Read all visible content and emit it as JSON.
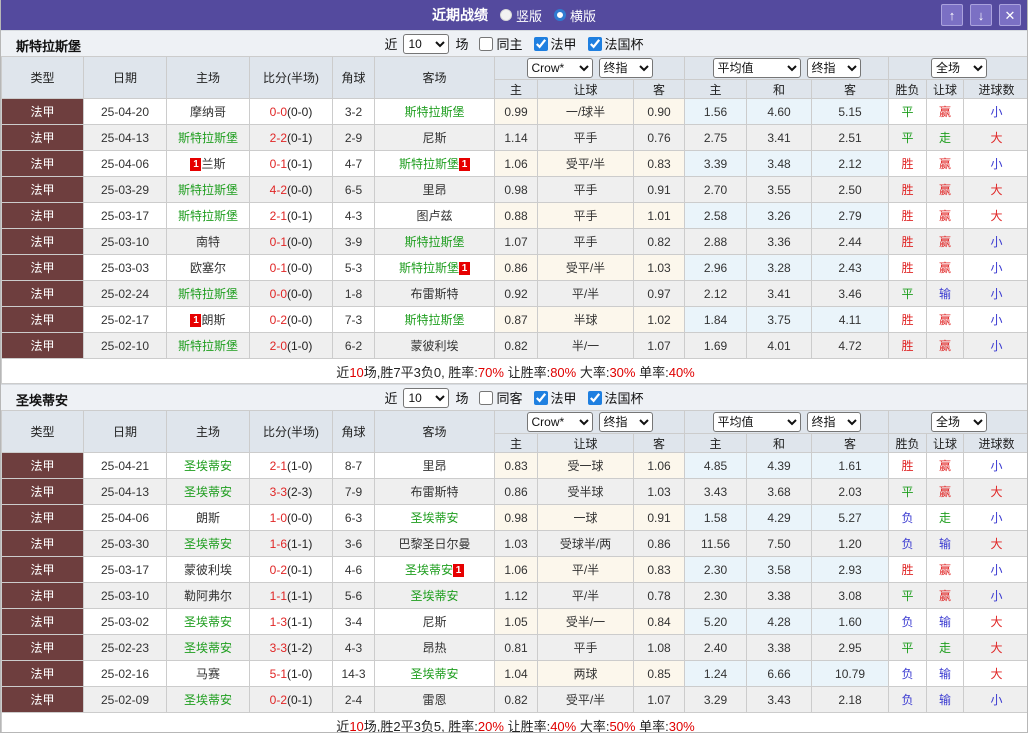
{
  "titlebar": {
    "title": "近期战绩",
    "vertical_label": "竖版",
    "horizontal_label": "横版",
    "buttons": {
      "up": "↑",
      "down": "↓",
      "close": "✕"
    },
    "bar_color": "#544a9e"
  },
  "filters": {
    "near_label": "近",
    "count_value": "10",
    "matches_label": "场",
    "league_label": "法甲",
    "cup_label": "法国杯"
  },
  "header": {
    "type": "类型",
    "date": "日期",
    "home": "主场",
    "score": "比分(半场)",
    "corner": "角球",
    "away": "客场",
    "selects": {
      "company": "Crow*",
      "final": "终指",
      "average": "平均值",
      "full": "全场"
    },
    "sub": {
      "home_odds": "主",
      "handicap": "让球",
      "away_odds": "客",
      "avg_home": "主",
      "avg_draw": "和",
      "avg_away": "客",
      "result": "胜负",
      "handicap_result": "让球",
      "goals": "进球数"
    }
  },
  "status_colors": {
    "win": "#e02626",
    "draw": "#1f9e1f",
    "lose": "#3b3bd1",
    "team": "#1f9e1f",
    "type_bg": "#6e3e3e"
  },
  "sections": [
    {
      "team": "斯特拉斯堡",
      "same_label": "同主",
      "rows": [
        {
          "league": "法甲",
          "date": "25-04-20",
          "home": "摩纳哥",
          "home_card": 0,
          "ft": "0-0",
          "ht": "(0-0)",
          "corner": "3-2",
          "away": "斯特拉斯堡",
          "away_card": 0,
          "o1": "0.99",
          "hc": "一/球半",
          "o2": "0.90",
          "a1": "1.56",
          "a2": "4.60",
          "a3": "5.15",
          "r1": "平",
          "r2": "赢",
          "r3": "小"
        },
        {
          "league": "法甲",
          "date": "25-04-13",
          "home": "斯特拉斯堡",
          "home_card": 0,
          "ft": "2-2",
          "ht": "(0-1)",
          "corner": "2-9",
          "away": "尼斯",
          "away_card": 0,
          "o1": "1.14",
          "hc": "平手",
          "o2": "0.76",
          "a1": "2.75",
          "a2": "3.41",
          "a3": "2.51",
          "r1": "平",
          "r2": "走",
          "r3": "大"
        },
        {
          "league": "法甲",
          "date": "25-04-06",
          "home": "兰斯",
          "home_card": 1,
          "ft": "0-1",
          "ht": "(0-1)",
          "corner": "4-7",
          "away": "斯特拉斯堡",
          "away_card": 1,
          "o1": "1.06",
          "hc": "受平/半",
          "o2": "0.83",
          "a1": "3.39",
          "a2": "3.48",
          "a3": "2.12",
          "r1": "胜",
          "r2": "赢",
          "r3": "小"
        },
        {
          "league": "法甲",
          "date": "25-03-29",
          "home": "斯特拉斯堡",
          "home_card": 0,
          "ft": "4-2",
          "ht": "(0-0)",
          "corner": "6-5",
          "away": "里昂",
          "away_card": 0,
          "o1": "0.98",
          "hc": "平手",
          "o2": "0.91",
          "a1": "2.70",
          "a2": "3.55",
          "a3": "2.50",
          "r1": "胜",
          "r2": "赢",
          "r3": "大"
        },
        {
          "league": "法甲",
          "date": "25-03-17",
          "home": "斯特拉斯堡",
          "home_card": 0,
          "ft": "2-1",
          "ht": "(0-1)",
          "corner": "4-3",
          "away": "图卢兹",
          "away_card": 0,
          "o1": "0.88",
          "hc": "平手",
          "o2": "1.01",
          "a1": "2.58",
          "a2": "3.26",
          "a3": "2.79",
          "r1": "胜",
          "r2": "赢",
          "r3": "大"
        },
        {
          "league": "法甲",
          "date": "25-03-10",
          "home": "南特",
          "home_card": 0,
          "ft": "0-1",
          "ht": "(0-0)",
          "corner": "3-9",
          "away": "斯特拉斯堡",
          "away_card": 0,
          "o1": "1.07",
          "hc": "平手",
          "o2": "0.82",
          "a1": "2.88",
          "a2": "3.36",
          "a3": "2.44",
          "r1": "胜",
          "r2": "赢",
          "r3": "小"
        },
        {
          "league": "法甲",
          "date": "25-03-03",
          "home": "欧塞尔",
          "home_card": 0,
          "ft": "0-1",
          "ht": "(0-0)",
          "corner": "5-3",
          "away": "斯特拉斯堡",
          "away_card": 1,
          "o1": "0.86",
          "hc": "受平/半",
          "o2": "1.03",
          "a1": "2.96",
          "a2": "3.28",
          "a3": "2.43",
          "r1": "胜",
          "r2": "赢",
          "r3": "小"
        },
        {
          "league": "法甲",
          "date": "25-02-24",
          "home": "斯特拉斯堡",
          "home_card": 0,
          "ft": "0-0",
          "ht": "(0-0)",
          "corner": "1-8",
          "away": "布雷斯特",
          "away_card": 0,
          "o1": "0.92",
          "hc": "平/半",
          "o2": "0.97",
          "a1": "2.12",
          "a2": "3.41",
          "a3": "3.46",
          "r1": "平",
          "r2": "输",
          "r3": "小"
        },
        {
          "league": "法甲",
          "date": "25-02-17",
          "home": "朗斯",
          "home_card": 1,
          "ft": "0-2",
          "ht": "(0-0)",
          "corner": "7-3",
          "away": "斯特拉斯堡",
          "away_card": 0,
          "o1": "0.87",
          "hc": "半球",
          "o2": "1.02",
          "a1": "1.84",
          "a2": "3.75",
          "a3": "4.11",
          "r1": "胜",
          "r2": "赢",
          "r3": "小"
        },
        {
          "league": "法甲",
          "date": "25-02-10",
          "home": "斯特拉斯堡",
          "home_card": 0,
          "ft": "2-0",
          "ht": "(1-0)",
          "corner": "6-2",
          "away": "蒙彼利埃",
          "away_card": 0,
          "o1": "0.82",
          "hc": "半/一",
          "o2": "1.07",
          "a1": "1.69",
          "a2": "4.01",
          "a3": "4.72",
          "r1": "胜",
          "r2": "赢",
          "r3": "小"
        }
      ],
      "summary": [
        {
          "t": "近"
        },
        {
          "t": "10",
          "r": 1
        },
        {
          "t": "场,胜7平3负0, 胜率:"
        },
        {
          "t": "70%",
          "r": 1
        },
        {
          "t": " 让胜率:"
        },
        {
          "t": "80%",
          "r": 1
        },
        {
          "t": " 大率:"
        },
        {
          "t": "30%",
          "r": 1
        },
        {
          "t": " 单率:"
        },
        {
          "t": "40%",
          "r": 1
        }
      ]
    },
    {
      "team": "圣埃蒂安",
      "same_label": "同客",
      "rows": [
        {
          "league": "法甲",
          "date": "25-04-21",
          "home": "圣埃蒂安",
          "home_card": 0,
          "ft": "2-1",
          "ht": "(1-0)",
          "corner": "8-7",
          "away": "里昂",
          "away_card": 0,
          "o1": "0.83",
          "hc": "受一球",
          "o2": "1.06",
          "a1": "4.85",
          "a2": "4.39",
          "a3": "1.61",
          "r1": "胜",
          "r2": "赢",
          "r3": "小"
        },
        {
          "league": "法甲",
          "date": "25-04-13",
          "home": "圣埃蒂安",
          "home_card": 0,
          "ft": "3-3",
          "ht": "(2-3)",
          "corner": "7-9",
          "away": "布雷斯特",
          "away_card": 0,
          "o1": "0.86",
          "hc": "受半球",
          "o2": "1.03",
          "a1": "3.43",
          "a2": "3.68",
          "a3": "2.03",
          "r1": "平",
          "r2": "赢",
          "r3": "大"
        },
        {
          "league": "法甲",
          "date": "25-04-06",
          "home": "朗斯",
          "home_card": 0,
          "ft": "1-0",
          "ht": "(0-0)",
          "corner": "6-3",
          "away": "圣埃蒂安",
          "away_card": 0,
          "o1": "0.98",
          "hc": "一球",
          "o2": "0.91",
          "a1": "1.58",
          "a2": "4.29",
          "a3": "5.27",
          "r1": "负",
          "r2": "走",
          "r3": "小"
        },
        {
          "league": "法甲",
          "date": "25-03-30",
          "home": "圣埃蒂安",
          "home_card": 0,
          "ft": "1-6",
          "ht": "(1-1)",
          "corner": "3-6",
          "away": "巴黎圣日尔曼",
          "away_card": 0,
          "o1": "1.03",
          "hc": "受球半/两",
          "o2": "0.86",
          "a1": "11.56",
          "a2": "7.50",
          "a3": "1.20",
          "r1": "负",
          "r2": "输",
          "r3": "大"
        },
        {
          "league": "法甲",
          "date": "25-03-17",
          "home": "蒙彼利埃",
          "home_card": 0,
          "ft": "0-2",
          "ht": "(0-1)",
          "corner": "4-6",
          "away": "圣埃蒂安",
          "away_card": 1,
          "o1": "1.06",
          "hc": "平/半",
          "o2": "0.83",
          "a1": "2.30",
          "a2": "3.58",
          "a3": "2.93",
          "r1": "胜",
          "r2": "赢",
          "r3": "小"
        },
        {
          "league": "法甲",
          "date": "25-03-10",
          "home": "勒阿弗尔",
          "home_card": 0,
          "ft": "1-1",
          "ht": "(1-1)",
          "corner": "5-6",
          "away": "圣埃蒂安",
          "away_card": 0,
          "o1": "1.12",
          "hc": "平/半",
          "o2": "0.78",
          "a1": "2.30",
          "a2": "3.38",
          "a3": "3.08",
          "r1": "平",
          "r2": "赢",
          "r3": "小"
        },
        {
          "league": "法甲",
          "date": "25-03-02",
          "home": "圣埃蒂安",
          "home_card": 0,
          "ft": "1-3",
          "ht": "(1-1)",
          "corner": "3-4",
          "away": "尼斯",
          "away_card": 0,
          "o1": "1.05",
          "hc": "受半/一",
          "o2": "0.84",
          "a1": "5.20",
          "a2": "4.28",
          "a3": "1.60",
          "r1": "负",
          "r2": "输",
          "r3": "大"
        },
        {
          "league": "法甲",
          "date": "25-02-23",
          "home": "圣埃蒂安",
          "home_card": 0,
          "ft": "3-3",
          "ht": "(1-2)",
          "corner": "4-3",
          "away": "昂热",
          "away_card": 0,
          "o1": "0.81",
          "hc": "平手",
          "o2": "1.08",
          "a1": "2.40",
          "a2": "3.38",
          "a3": "2.95",
          "r1": "平",
          "r2": "走",
          "r3": "大"
        },
        {
          "league": "法甲",
          "date": "25-02-16",
          "home": "马赛",
          "home_card": 0,
          "ft": "5-1",
          "ht": "(1-0)",
          "corner": "14-3",
          "away": "圣埃蒂安",
          "away_card": 0,
          "o1": "1.04",
          "hc": "两球",
          "o2": "0.85",
          "a1": "1.24",
          "a2": "6.66",
          "a3": "10.79",
          "r1": "负",
          "r2": "输",
          "r3": "大"
        },
        {
          "league": "法甲",
          "date": "25-02-09",
          "home": "圣埃蒂安",
          "home_card": 0,
          "ft": "0-2",
          "ht": "(0-1)",
          "corner": "2-4",
          "away": "雷恩",
          "away_card": 0,
          "o1": "0.82",
          "hc": "受平/半",
          "o2": "1.07",
          "a1": "3.29",
          "a2": "3.43",
          "a3": "2.18",
          "r1": "负",
          "r2": "输",
          "r3": "小"
        }
      ],
      "summary": [
        {
          "t": "近"
        },
        {
          "t": "10",
          "r": 1
        },
        {
          "t": "场,胜2平3负5, 胜率:"
        },
        {
          "t": "20%",
          "r": 1
        },
        {
          "t": " 让胜率:"
        },
        {
          "t": "40%",
          "r": 1
        },
        {
          "t": " 大率:"
        },
        {
          "t": "50%",
          "r": 1
        },
        {
          "t": " 单率:"
        },
        {
          "t": "30%",
          "r": 1
        }
      ]
    }
  ]
}
